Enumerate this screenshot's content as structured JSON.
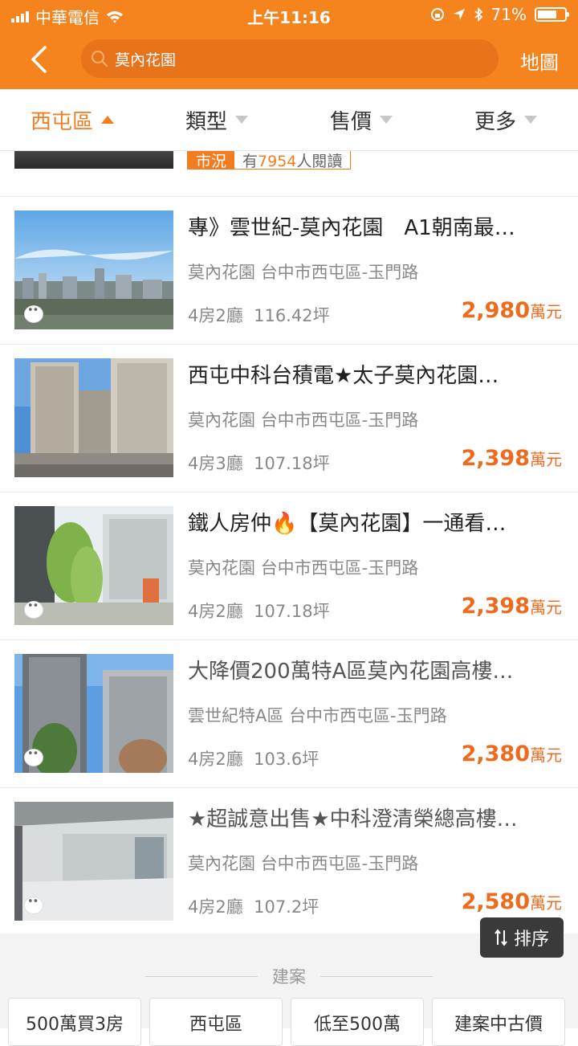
{
  "status": {
    "carrier": "中華電信",
    "time": "上午11:16",
    "battery": "71%",
    "battery_level": 0.71
  },
  "header": {
    "search_value": "莫內花園",
    "map_link": "地圖"
  },
  "filters": [
    {
      "label": "西屯區",
      "active": true
    },
    {
      "label": "類型",
      "active": false
    },
    {
      "label": "售價",
      "active": false
    },
    {
      "label": "更多",
      "active": false
    }
  ],
  "prev_item": {
    "tag_key": "市況",
    "tag_pre": "有",
    "tag_num": "7954",
    "tag_post": "人閱讀"
  },
  "listings": [
    {
      "title": "專》雲世紀-莫內花園　A1朝南最…",
      "community": "莫內花園",
      "location": "台中市西屯區-玉門路",
      "rooms": "4房2廳",
      "area": "116.42坪",
      "price": "2,980",
      "unit": "萬元"
    },
    {
      "title": "西屯中科台積電★太子莫內花園…",
      "community": "莫內花園",
      "location": "台中市西屯區-玉門路",
      "rooms": "4房3廳",
      "area": "107.18坪",
      "price": "2,398",
      "unit": "萬元"
    },
    {
      "title": "鐵人房仲🔥【莫內花園】一通看…",
      "community": "莫內花園",
      "location": "台中市西屯區-玉門路",
      "rooms": "4房2廳",
      "area": "107.18坪",
      "price": "2,398",
      "unit": "萬元"
    },
    {
      "title": "大降價200萬特A區莫內花園高樓…",
      "community": "雲世紀特A區",
      "location": "台中市西屯區-玉門路",
      "rooms": "4房2廳",
      "area": "103.6坪",
      "price": "2,380",
      "unit": "萬元"
    },
    {
      "title": "★超誠意出售★中科澄清榮總高樓…",
      "community": "莫內花園",
      "location": "台中市西屯區-玉門路",
      "rooms": "4房2廳",
      "area": "107.2坪",
      "price": "2,580",
      "unit": "萬元"
    }
  ],
  "sort_button": "排序",
  "section_title": "建案",
  "chips": [
    "500萬買3房",
    "西屯區",
    "低至500萬",
    "建案中古價"
  ],
  "colors": {
    "brand": "#f5841e",
    "price": "#f06a1e"
  }
}
